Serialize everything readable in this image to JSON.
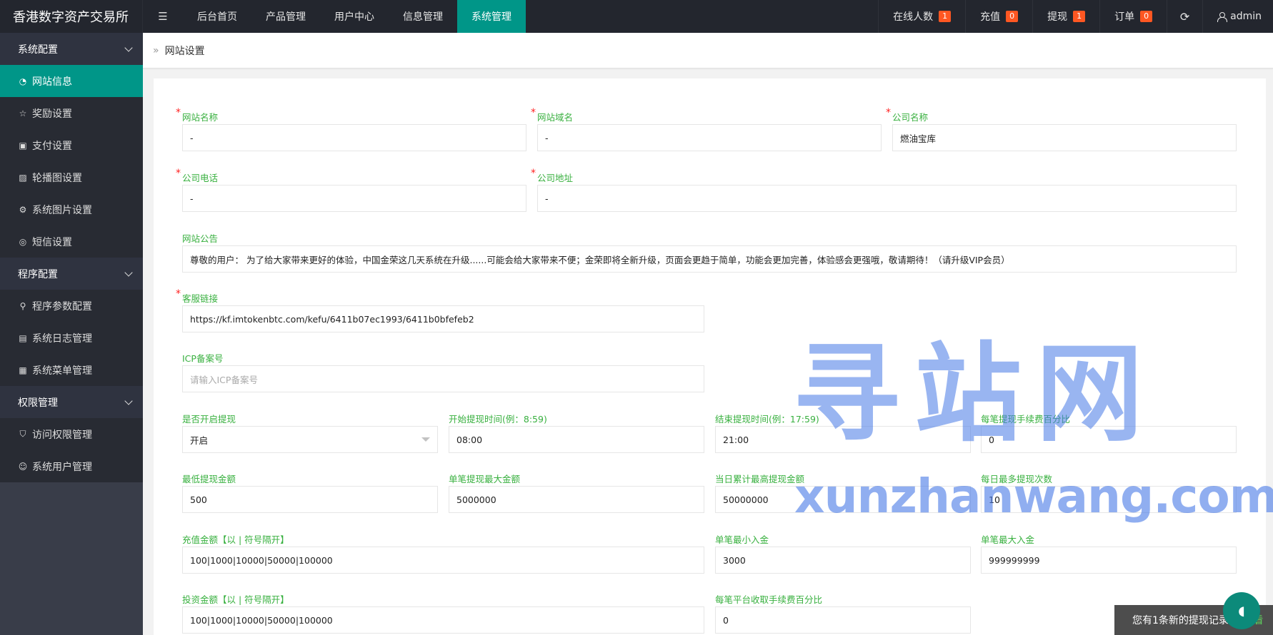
{
  "app": {
    "title": "香港数字资产交易所"
  },
  "header": {
    "nav": [
      {
        "label": "后台首页"
      },
      {
        "label": "产品管理"
      },
      {
        "label": "用户中心"
      },
      {
        "label": "信息管理"
      },
      {
        "label": "系统管理",
        "active": true
      }
    ],
    "stats": [
      {
        "label": "在线人数",
        "count": "1"
      },
      {
        "label": "充值",
        "count": "0"
      },
      {
        "label": "提现",
        "count": "1"
      },
      {
        "label": "订单",
        "count": "0"
      }
    ],
    "user": "admin",
    "accent": "#009688",
    "badge_color": "#ff5722"
  },
  "sidebar": {
    "groups": [
      {
        "label": "系统配置",
        "items": [
          {
            "label": "网站信息",
            "icon": "dashboard-icon",
            "active": true
          },
          {
            "label": "奖励设置",
            "icon": "star-icon"
          },
          {
            "label": "支付设置",
            "icon": "money-icon"
          },
          {
            "label": "轮播图设置",
            "icon": "picture-icon"
          },
          {
            "label": "系统图片设置",
            "icon": "gear-icon"
          },
          {
            "label": "短信设置",
            "icon": "chat-icon"
          }
        ]
      },
      {
        "label": "程序配置",
        "items": [
          {
            "label": "程序参数配置",
            "icon": "link-icon"
          },
          {
            "label": "系统日志管理",
            "icon": "log-icon"
          },
          {
            "label": "系统菜单管理",
            "icon": "menu-table-icon"
          }
        ]
      },
      {
        "label": "权限管理",
        "items": [
          {
            "label": "访问权限管理",
            "icon": "shield-icon"
          },
          {
            "label": "系统用户管理",
            "icon": "user-icon"
          }
        ]
      }
    ]
  },
  "breadcrumb": {
    "current": "网站设置"
  },
  "form": {
    "site_name": {
      "label": "网站名称",
      "value": "-"
    },
    "site_domain": {
      "label": "网站域名",
      "value": "-"
    },
    "company_name": {
      "label": "公司名称",
      "value": "燃油宝库"
    },
    "company_phone": {
      "label": "公司电话",
      "value": "-"
    },
    "company_address": {
      "label": "公司地址",
      "value": "-"
    },
    "notice": {
      "label": "网站公告",
      "value": "尊敬的用户： 为了给大家带来更好的体验，中国金荣这几天系统在升级......可能会给大家带来不便；金荣即将全新升级，页面会更趋于简单，功能会更加完善，体验感会更强哦，敬请期待！（请升级VIP会员）"
    },
    "service_link": {
      "label": "客服链接",
      "value": "https://kf.imtokenbtc.com/kefu/6411b07ec1993/6411b0bfefeb2"
    },
    "icp": {
      "label": "ICP备案号",
      "placeholder": "请输入ICP备案号"
    },
    "withdraw_enabled": {
      "label": "是否开启提现",
      "value": "开启"
    },
    "withdraw_start": {
      "label": "开始提现时间(例：8:59)",
      "value": "08:00"
    },
    "withdraw_end": {
      "label": "结束提现时间(例：17:59)",
      "value": "21:00"
    },
    "withdraw_fee": {
      "label": "每笔提现手续费百分比",
      "value": "0"
    },
    "min_withdraw": {
      "label": "最低提现金额",
      "value": "500"
    },
    "max_withdraw_single": {
      "label": "单笔提现最大金额",
      "value": "5000000"
    },
    "max_withdraw_daily": {
      "label": "当日累计最高提现金额",
      "value": "50000000"
    },
    "max_withdraw_times": {
      "label": "每日最多提现次数",
      "value": "10"
    },
    "recharge_amounts": {
      "label": "充值金额【以 | 符号隔开】",
      "value": "100|1000|10000|50000|100000"
    },
    "min_deposit": {
      "label": "单笔最小入金",
      "value": "3000"
    },
    "max_deposit": {
      "label": "单笔最大入金",
      "value": "999999999"
    },
    "invest_amounts": {
      "label": "投资金额【以 | 符号隔开】",
      "value": "100|1000|10000|50000|100000"
    },
    "platform_fee": {
      "label": "每笔平台收取手续费百分比",
      "value": "0"
    }
  },
  "watermark": {
    "big": "寻站网",
    "small": "xunzhanwang.com"
  },
  "toast": {
    "text": "您有1条新的提现记录,",
    "link": "请查看"
  }
}
